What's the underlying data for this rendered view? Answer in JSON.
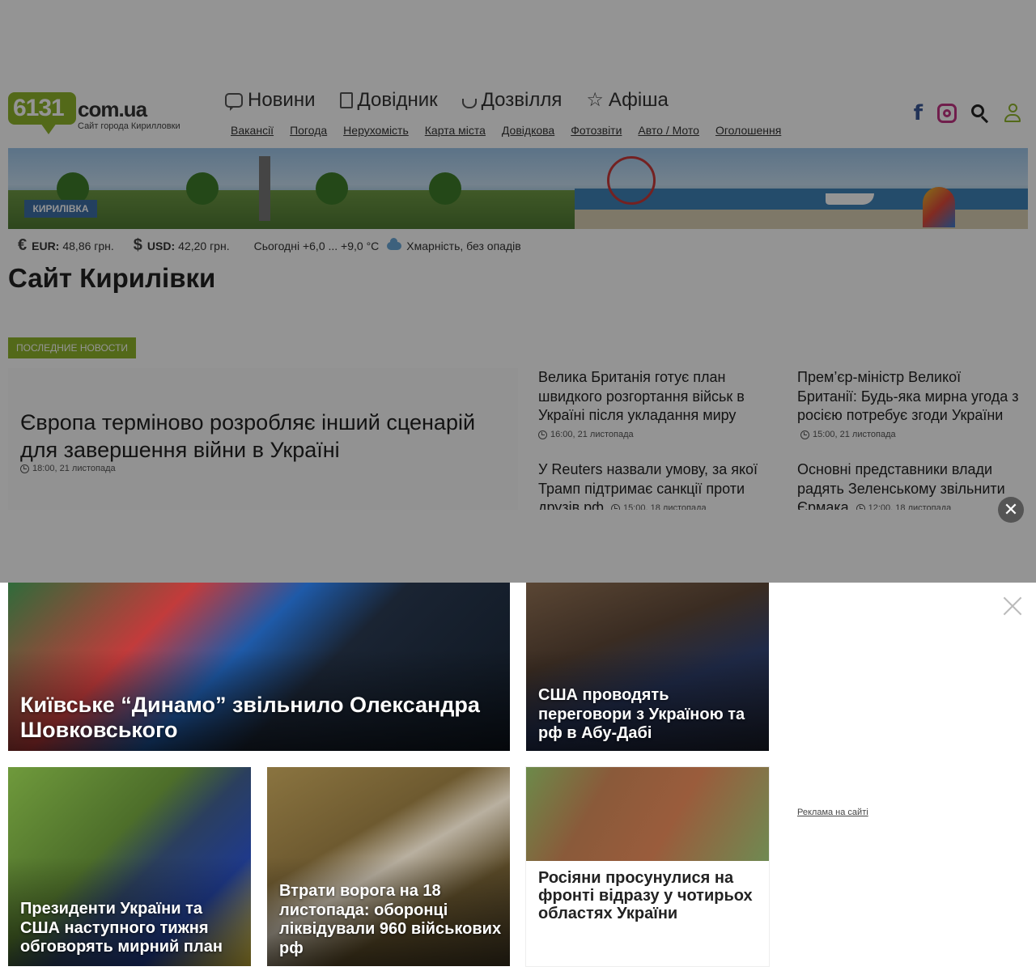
{
  "logo": {
    "number": "6131",
    "domain": "com.ua",
    "subtitle": "Сайт города Кирилловки"
  },
  "main_nav": [
    {
      "label": "Новини",
      "icon": "chat-bubble-icon"
    },
    {
      "label": "Довідник",
      "icon": "book-icon"
    },
    {
      "label": "Дозвілля",
      "icon": "cup-icon"
    },
    {
      "label": "Афіша",
      "icon": "star-icon"
    }
  ],
  "sub_nav": [
    "Вакансії",
    "Погода",
    "Нерухомість",
    "Карта міста",
    "Довідкова",
    "Фотозвіти",
    "Авто / Мото",
    "Оголошення"
  ],
  "banner": {
    "sign": "КИРИЛІВКА"
  },
  "info_bar": {
    "eur_label": "EUR:",
    "eur_value": "48,86 грн.",
    "usd_label": "USD:",
    "usd_value": "42,20 грн.",
    "weather_temp": "Сьогодні +6,0 ... +9,0 °C",
    "weather_desc": "Хмарність, без опадів"
  },
  "site_title": "Сайт Кирилівки",
  "latest": {
    "badge": "ПОСЛЕДНИЕ НОВОСТИ",
    "lead": {
      "title": "Європа терміново розробляє інший сценарій для завершення війни в Україні",
      "time": "18:00, 21 листопада"
    },
    "items": [
      {
        "title": "Велика Британія готує план швидкого розгортання військ в Україні після укладання миру",
        "time": "16:00, 21 листопада"
      },
      {
        "title": "Прем’єр-міністр Великої Британії: Будь-яка мирна угода з росією потребує згоди України",
        "time": "15:00, 21 листопада"
      },
      {
        "title": "У Reuters назвали умову, за якої Трамп підтримає санкції проти друзів рф",
        "time": "15:00, 18 листопада"
      },
      {
        "title": "Основні представники влади радять Зеленському звільнити Єрмака",
        "time": "12:00, 18 листопада"
      }
    ]
  },
  "cards": [
    {
      "title": "Київське “Динамо” звільнило Олександра Шовковського"
    },
    {
      "title": "США проводять переговори з Україною та рф в Абу-Дабі"
    },
    {
      "title": "Президенти України та США наступного тижня обговорять мирний план"
    },
    {
      "title": "Втрати ворога на 18 листопада: оборонці ліквідували 960 військових рф"
    },
    {
      "title": "Росіяни просунулися на фронті відразу у чотирьох областях України"
    }
  ],
  "ad_link": "Реклама на сайті",
  "colors": {
    "accent": "#8fb52c",
    "facebook": "#3b5998",
    "instagram": "#c13584"
  }
}
